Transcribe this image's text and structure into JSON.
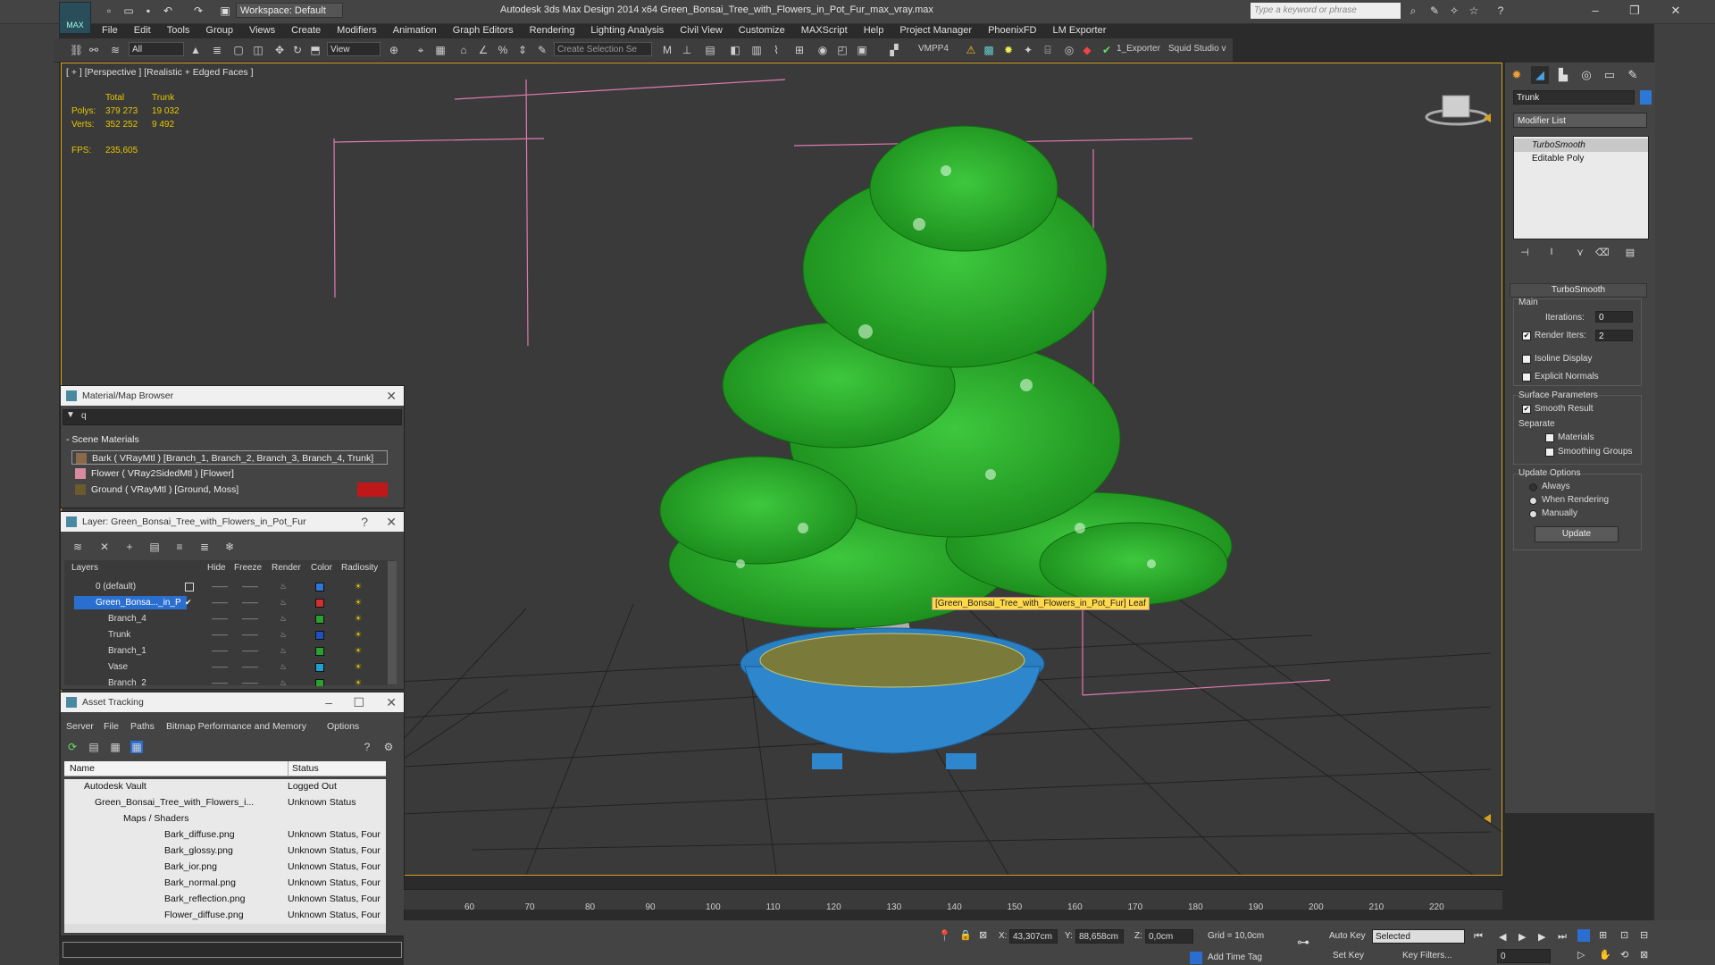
{
  "app": {
    "title": "Autodesk 3ds Max Design 2014 x64      Green_Bonsai_Tree_with_Flowers_in_Pot_Fur_max_vray.max",
    "logo_text": "MAX",
    "workspace": "Workspace: Default",
    "search_placeholder": "Type a keyword or phrase"
  },
  "menu": [
    "File",
    "Edit",
    "Tools",
    "Group",
    "Views",
    "Create",
    "Modifiers",
    "Animation",
    "Graph Editors",
    "Rendering",
    "Lighting Analysis",
    "Civil View",
    "Customize",
    "MAXScript",
    "Help",
    "Project Manager",
    "PhoenixFD",
    "LM Exporter"
  ],
  "toolbar": {
    "selection_filter": "All",
    "reference_coord": "View",
    "selection_set": "Create Selection Se",
    "vmpp": "VMPP4",
    "exporter": "1_Exporter",
    "squid": "Squid Studio v"
  },
  "viewport": {
    "label": "[ + ] [Perspective ] [Realistic + Edged Faces ]",
    "stats_col_total": "Total",
    "stats_col_obj": "Trunk",
    "polys_label": "Polys:",
    "polys_total": "379 273",
    "polys_obj": "19 032",
    "verts_label": "Verts:",
    "verts_total": "352 252",
    "verts_obj": "9 492",
    "fps_label": "FPS:",
    "fps_value": "235,605",
    "tooltip": "[Green_Bonsai_Tree_with_Flowers_in_Pot_Fur] Leaf",
    "viewcube_label": "FRONT"
  },
  "command_panel": {
    "object_name": "Trunk",
    "object_color": "#2b78d6",
    "modifier_list": "Modifier List",
    "stack": [
      "TurboSmooth",
      "Editable Poly"
    ],
    "rollout_title": "TurboSmooth",
    "main_label": "Main",
    "iterations_label": "Iterations:",
    "iterations_value": "0",
    "render_iters_label": "Render Iters:",
    "render_iters_value": "2",
    "isoline": "Isoline Display",
    "explicit_normals": "Explicit Normals",
    "surface_params": "Surface Parameters",
    "smooth_result": "Smooth Result",
    "separate": "Separate",
    "materials": "Materials",
    "smoothing_groups": "Smoothing Groups",
    "update_options": "Update Options",
    "always": "Always",
    "when_rendering": "When Rendering",
    "manually": "Manually",
    "update_btn": "Update"
  },
  "material_browser": {
    "title": "Material/Map Browser",
    "search_value": "q",
    "section": "- Scene Materials",
    "items": [
      {
        "label": "Bark  ( VRayMtl )  [Branch_1, Branch_2, Branch_3, Branch_4, Trunk]",
        "swatch": "#8a6a4a"
      },
      {
        "label": "Flower  ( VRay2SidedMtl )  [Flower]",
        "swatch": "#d88aa0"
      },
      {
        "label": "Ground  ( VRayMtl )  [Ground, Moss]",
        "swatch": "#6a5a30"
      }
    ]
  },
  "layer_dialog": {
    "title": "Layer: Green_Bonsai_Tree_with_Flowers_in_Pot_Fur",
    "headers": [
      "Layers",
      "Hide",
      "Freeze",
      "Render",
      "Color",
      "Radiosity"
    ],
    "rows": [
      {
        "name": "0 (default)",
        "color": "#2b78d6"
      },
      {
        "name": "Green_Bonsa..._in_P",
        "color": "#d03030"
      },
      {
        "name": "Branch_4",
        "color": "#2aa030"
      },
      {
        "name": "Trunk",
        "color": "#2050c0"
      },
      {
        "name": "Branch_1",
        "color": "#2aa030"
      },
      {
        "name": "Vase",
        "color": "#20a0d0"
      },
      {
        "name": "Branch_2",
        "color": "#2aa030"
      }
    ]
  },
  "asset_tracking": {
    "title": "Asset Tracking",
    "menu": [
      "Server",
      "File",
      "Paths",
      "Bitmap Performance and Memory",
      "Options"
    ],
    "col_name": "Name",
    "col_status": "Status",
    "rows": [
      {
        "name": "Autodesk Vault",
        "status": "Logged Out"
      },
      {
        "name": "Green_Bonsai_Tree_with_Flowers_i...",
        "status": "Unknown Status"
      },
      {
        "name": "Maps / Shaders",
        "status": ""
      },
      {
        "name": "Bark_diffuse.png",
        "status": "Unknown Status, Four"
      },
      {
        "name": "Bark_glossy.png",
        "status": "Unknown Status, Four"
      },
      {
        "name": "Bark_ior.png",
        "status": "Unknown Status, Four"
      },
      {
        "name": "Bark_normal.png",
        "status": "Unknown Status, Four"
      },
      {
        "name": "Bark_reflection.png",
        "status": "Unknown Status, Four"
      },
      {
        "name": "Flower_diffuse.png",
        "status": "Unknown Status, Four"
      }
    ]
  },
  "timeline": {
    "ticks": [
      "60",
      "70",
      "80",
      "90",
      "100",
      "110",
      "120",
      "130",
      "140",
      "150",
      "160",
      "170",
      "180",
      "190",
      "200",
      "210",
      "220"
    ]
  },
  "statusbar": {
    "x_label": "X:",
    "x_value": "43,307cm",
    "y_label": "Y:",
    "y_value": "88,658cm",
    "z_label": "Z:",
    "z_value": "0,0cm",
    "grid": "Grid = 10,0cm",
    "add_time_tag": "Add Time Tag",
    "auto_key": "Auto Key",
    "selected": "Selected",
    "set_key": "Set Key",
    "key_filters": "Key Filters...",
    "frame": "0"
  }
}
